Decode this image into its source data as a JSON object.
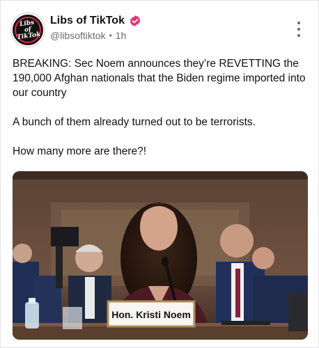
{
  "post": {
    "author": {
      "display_name": "Libs of TikTok",
      "handle": "@libsoftiktok",
      "separator": "•",
      "time_ago": "1h",
      "avatar_text": "Libs of TikTok",
      "verified_icon": "verified-badge-icon",
      "verified_color": "#e8306b"
    },
    "text": [
      "BREAKING: Sec Noem announces they’re REVETTING the 190,000 Afghan nationals that the Biden regime imported into our country",
      "A bunch of them already turned out to be terrorists.",
      "How many more are there?!"
    ],
    "media": {
      "nameplate": "Hon. Kristi Noem",
      "icon": "photo"
    },
    "menu_icon": "more-vertical-icon"
  }
}
